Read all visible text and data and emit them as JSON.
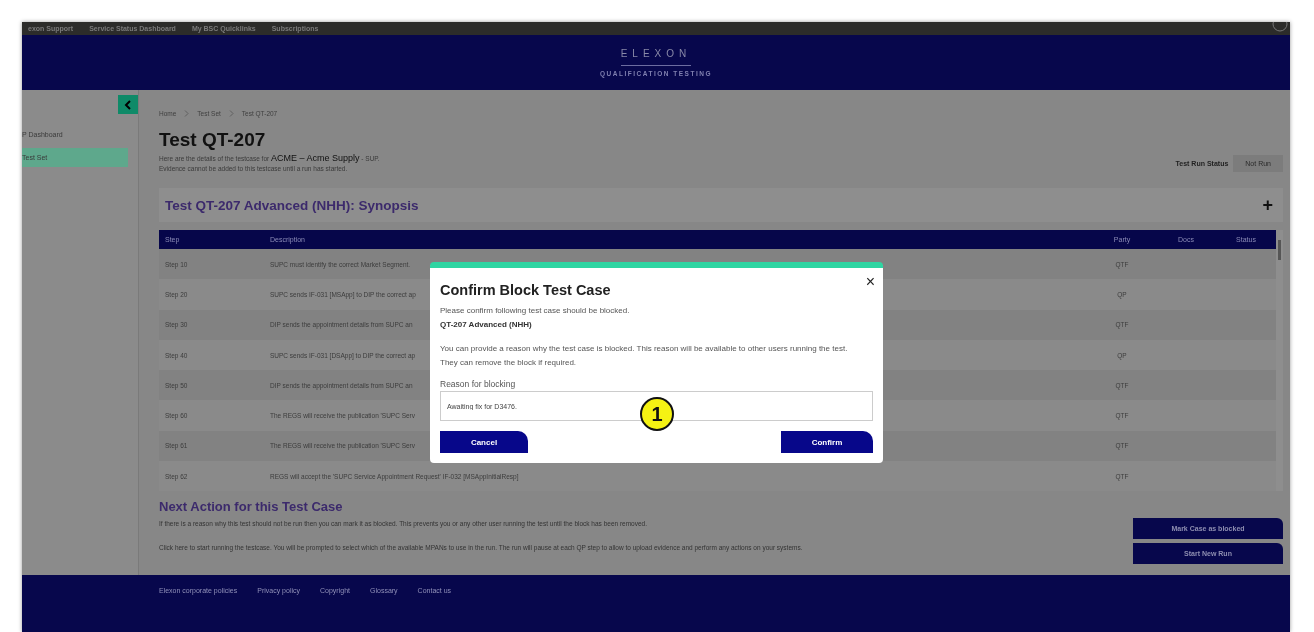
{
  "top_bar": {
    "links": [
      "exon Support",
      "Service Status Dashboard",
      "My BSC Quicklinks",
      "Subscriptions"
    ]
  },
  "header": {
    "logo": "ELEXON",
    "subtitle": "QUALIFICATION TESTING"
  },
  "sidebar": {
    "items": [
      {
        "label": "P Dashboard",
        "selected": false
      },
      {
        "label": "Test Set",
        "selected": true
      }
    ]
  },
  "breadcrumb": [
    "Home",
    "Test Set",
    "Test QT-207"
  ],
  "page": {
    "title": "Test QT-207",
    "intro": "Here are the details of the testcase for **ACME – Acme Supply** - SUP.",
    "note": "Evidence cannot be added to this testcase until a run has started.",
    "status_label": "Test Run Status",
    "status_value": "Not Run"
  },
  "synopsis": {
    "title": "Test QT-207 Advanced (NHH): Synopsis",
    "add": "+"
  },
  "table": {
    "columns": [
      "Step",
      "Description",
      "Party",
      "Docs",
      "Status"
    ],
    "rows": [
      {
        "step": "Step 10",
        "description": "SUPC must identify the correct Market Segment.",
        "party": "QTF"
      },
      {
        "step": "Step 20",
        "description": "SUPC sends IF-031 [MSApp] to DIP the correct ap",
        "party": "QP"
      },
      {
        "step": "Step 30",
        "description": "DIP sends the appointment details from SUPC an",
        "party": "QTF"
      },
      {
        "step": "Step 40",
        "description": "SUPC sends IF-031 [DSApp] to DIP the correct ap",
        "party": "QP"
      },
      {
        "step": "Step 50",
        "description": "DIP sends the appointment details from SUPC an",
        "party": "QTF"
      },
      {
        "step": "Step 60",
        "description": "The REGS will receive the publication 'SUPC Serv",
        "party": "QTF"
      },
      {
        "step": "Step 61",
        "description": "The REGS will receive the publication 'SUPC Serv",
        "party": "QTF"
      },
      {
        "step": "Step 62",
        "description": "REGS will accept the 'SUPC Service Appointment Request' IF-032 [MSAppInitialResp]",
        "party": "QTF"
      }
    ]
  },
  "next_action": {
    "title": "Next Action for this Test Case",
    "lines": [
      "If there is a reason why this test should not be run then you can mark it as blocked. This prevents you or any other user running the test until the block has been removed.",
      "Click here to start running the testcase. You will be prompted to select which of the available MPANs to use in the run. The run will pause at each QP step to allow to upload evidence and perform any actions on your systems."
    ],
    "buttons": [
      "Mark Case as blocked",
      "Start New Run"
    ]
  },
  "footer": {
    "links": [
      "Elexon corporate policies",
      "Privacy policy",
      "Copyright",
      "Glossary",
      "Contact us"
    ]
  },
  "dialog": {
    "title": "Confirm Block Test Case",
    "close": "×",
    "prompt": "Please confirm following test case should be blocked.",
    "case_name": "QT-207 Advanced (NHH)",
    "explanation": "You can provide a reason why the test case is blocked. This reason will be available to other users running the test. They can remove the block if required.",
    "field_label": "Reason for blocking",
    "field_value": "Awaiting fix for D3476.",
    "buttons": [
      "Cancel",
      "Confirm"
    ]
  },
  "callout": "1"
}
